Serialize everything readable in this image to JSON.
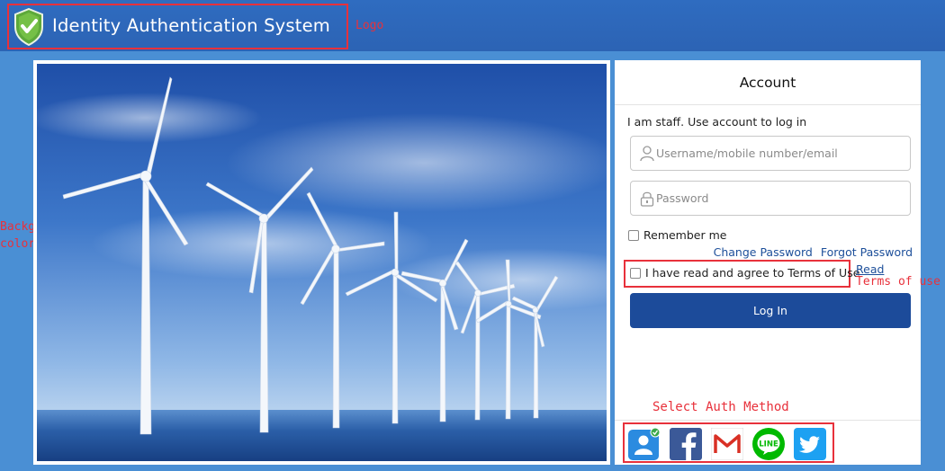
{
  "header": {
    "title": "Identity Authentication System",
    "logo_icon": "green-shield-check-icon"
  },
  "annotations": {
    "logo": "Logo",
    "background_color": [
      "Background",
      "color"
    ],
    "terms_of_use": "Terms of use",
    "select_auth_method": "Select Auth Method"
  },
  "colors": {
    "background": "#4a8fd4",
    "header": "#2c63b4",
    "primary_button": "#1c4b9a",
    "annotation": "#e8313b",
    "link": "#1d4f9a"
  },
  "login": {
    "title": "Account",
    "staff_text": "I am staff. Use account to log in",
    "username_placeholder": "Username/mobile number/email",
    "username_value": "",
    "password_placeholder": "Password",
    "password_value": "",
    "remember_me": "Remember me",
    "remember_checked": false,
    "change_password": "Change Password",
    "forgot_password": "Forgot Password",
    "terms_text": "I have read and agree to Terms of Use",
    "terms_checked": false,
    "read_link": "Read",
    "login_button": "Log In"
  },
  "auth_methods": [
    {
      "icon": "account-icon",
      "selected": true
    },
    {
      "icon": "facebook-icon",
      "selected": false
    },
    {
      "icon": "gmail-icon",
      "selected": false
    },
    {
      "icon": "line-icon",
      "selected": false,
      "label": "LINE"
    },
    {
      "icon": "twitter-icon",
      "selected": false
    }
  ]
}
